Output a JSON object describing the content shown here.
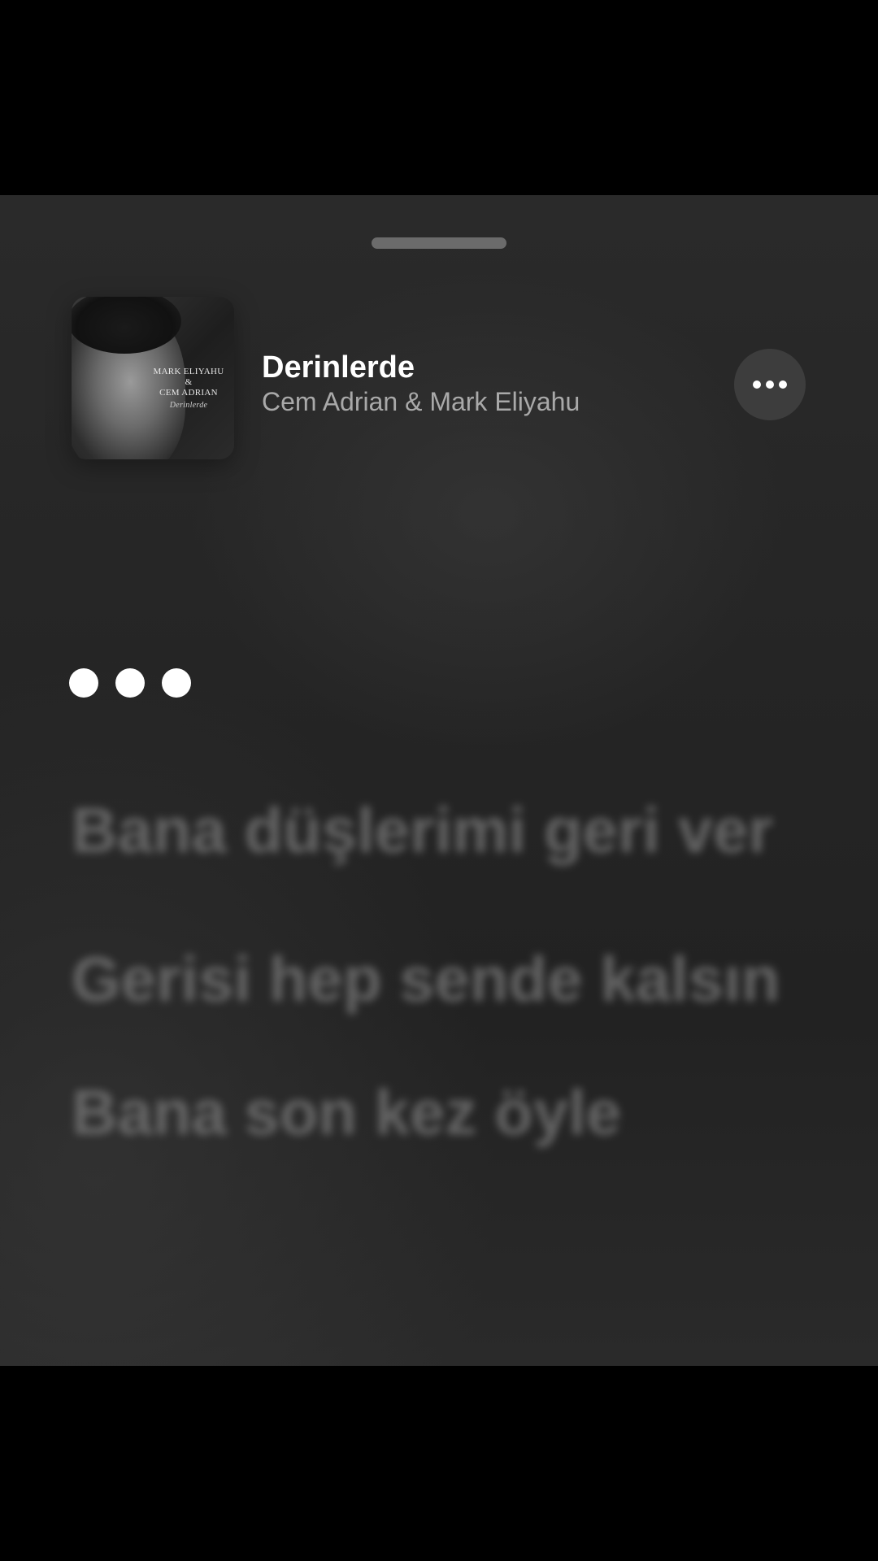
{
  "now_playing": {
    "title": "Derinlerde",
    "artist": "Cem Adrian & Mark Eliyahu",
    "artwork": {
      "line1": "MARK ELIYAHU",
      "line2": "&",
      "line3": "CEM ADRIAN",
      "script": "Derinlerde"
    }
  },
  "more_button": {
    "icon": "more-horizontal-icon"
  },
  "lyrics": {
    "loading_indicator": "typing-dots",
    "lines": [
      "Bana düşlerimi geri ver",
      "Gerisi hep sende kalsın",
      "Bana son kez öyle"
    ]
  }
}
